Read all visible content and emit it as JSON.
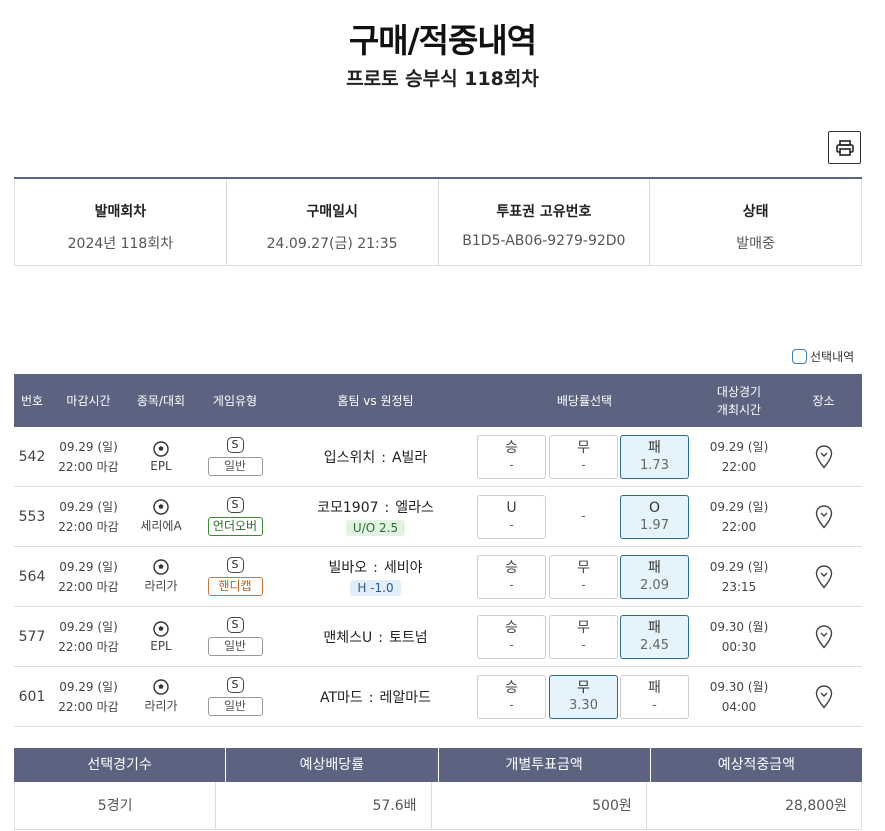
{
  "header": {
    "title": "구매/적중내역",
    "subtitle": "프로토 승부식 118회차"
  },
  "info": [
    {
      "label": "발매회차",
      "value": "2024년 118회차"
    },
    {
      "label": "구매일시",
      "value": "24.09.27(금) 21:35"
    },
    {
      "label": "투표권 고유번호",
      "value": "B1D5-AB06-9279-92D0"
    },
    {
      "label": "상태",
      "value": "발매중"
    }
  ],
  "select_label": "선택내역",
  "table_headers": {
    "no": "번호",
    "deadline": "마감시간",
    "league": "종목/대회",
    "type": "게임유형",
    "match": "홈팀 vs 원정팀",
    "odds": "배당률선택",
    "event_time_1": "대상경기",
    "event_time_2": "개최시간",
    "place": "장소"
  },
  "rows": [
    {
      "no": "542",
      "date": "09.29 (일)",
      "time": "22:00 마감",
      "league": "EPL",
      "s": "S",
      "type": "일반",
      "home": "입스위치",
      "sep": ":",
      "away": "A빌라",
      "line": "",
      "o1": {
        "label": "승",
        "value": "-"
      },
      "o2": {
        "label": "무",
        "value": "-"
      },
      "o3": {
        "label": "패",
        "value": "1.73"
      },
      "edate": "09.29 (일)",
      "etime": "22:00"
    },
    {
      "no": "553",
      "date": "09.29 (일)",
      "time": "22:00 마감",
      "league": "세리에A",
      "s": "S",
      "type": "언더오버",
      "home": "코모1907",
      "sep": ":",
      "away": "엘라스",
      "line": "U/O 2.5",
      "o1": {
        "label": "U",
        "value": "-"
      },
      "o2": {
        "label": "",
        "value": "-"
      },
      "o3": {
        "label": "O",
        "value": "1.97"
      },
      "edate": "09.29 (일)",
      "etime": "22:00"
    },
    {
      "no": "564",
      "date": "09.29 (일)",
      "time": "22:00 마감",
      "league": "라리가",
      "s": "S",
      "type": "핸디캡",
      "home": "빌바오",
      "sep": ":",
      "away": "세비야",
      "line": "H -1.0",
      "o1": {
        "label": "승",
        "value": "-"
      },
      "o2": {
        "label": "무",
        "value": "-"
      },
      "o3": {
        "label": "패",
        "value": "2.09"
      },
      "edate": "09.29 (일)",
      "etime": "23:15"
    },
    {
      "no": "577",
      "date": "09.29 (일)",
      "time": "22:00 마감",
      "league": "EPL",
      "s": "S",
      "type": "일반",
      "home": "맨체스U",
      "sep": ":",
      "away": "토트넘",
      "line": "",
      "o1": {
        "label": "승",
        "value": "-"
      },
      "o2": {
        "label": "무",
        "value": "-"
      },
      "o3": {
        "label": "패",
        "value": "2.45"
      },
      "edate": "09.30 (월)",
      "etime": "00:30"
    },
    {
      "no": "601",
      "date": "09.29 (일)",
      "time": "22:00 마감",
      "league": "라리가",
      "s": "S",
      "type": "일반",
      "home": "AT마드",
      "sep": ":",
      "away": "레알마드",
      "line": "",
      "o1": {
        "label": "승",
        "value": "-"
      },
      "o2": {
        "label": "무",
        "value": "3.30"
      },
      "o3": {
        "label": "패",
        "value": "-"
      },
      "edate": "09.30 (월)",
      "etime": "04:00"
    }
  ],
  "summary": {
    "headers": [
      "선택경기수",
      "예상배당률",
      "개별투표금액",
      "예상적중금액"
    ],
    "values": [
      "5경기",
      "57.6배",
      "500원",
      "28,800원"
    ]
  }
}
